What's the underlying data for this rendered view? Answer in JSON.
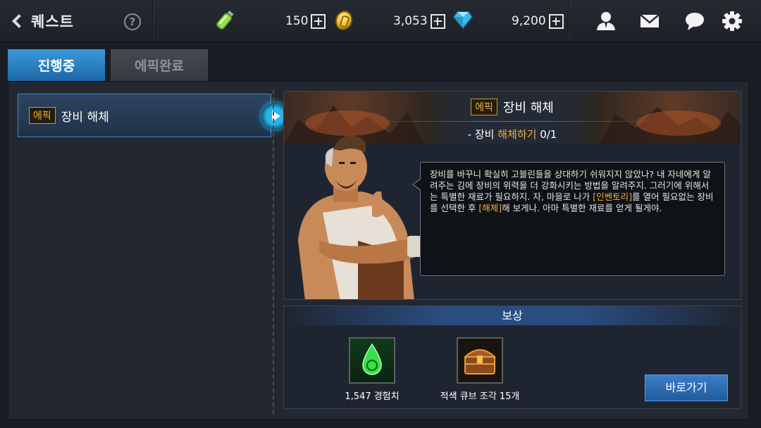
{
  "header": {
    "title": "퀘스트",
    "help_glyph": "?",
    "stamina": "150",
    "gold": "3,053",
    "gems": "9,200",
    "icons": [
      "back-chevron-icon",
      "help-icon",
      "stamina-potion-icon",
      "gold-coin-icon",
      "gem-icon",
      "friend-icon",
      "mail-icon",
      "chat-icon",
      "settings-icon"
    ]
  },
  "tabs": [
    {
      "label": "진행중",
      "active": true
    },
    {
      "label": "에픽완료",
      "active": false
    }
  ],
  "quest_list": [
    {
      "badge": "에픽",
      "name": "장비 해체",
      "selected": true
    }
  ],
  "detail": {
    "badge": "에픽",
    "title": "장비 해체",
    "objective_prefix": "- 장비 ",
    "objective_action": "해체하기",
    "objective_progress": " 0/1",
    "dialog": {
      "p1": "장비를 바꾸니 확실히 고블린들을 상대하기 쉬워지지 않았나?  내 자네에게 알려주는 김에 장비의 위력을 더 강화시키는 방법을 알려주지. 그러기에 위해서는 특별한 재료가 필요하지.  자, 마을로 나가 ",
      "hl1": "[인벤토리]",
      "p2": "를 열어 필요없는 장비를 선택한 후 ",
      "hl2": "[해체]",
      "p3": "해 보게나. 아마 특별한 재료를 얻게 될게야."
    }
  },
  "reward": {
    "header": "보상",
    "items": [
      {
        "label": "1,547 경험치",
        "icon": "exp-drop-icon"
      },
      {
        "label": "적색 큐브 조각 15개",
        "icon": "treasure-chest-icon"
      }
    ],
    "goto_label": "바로가기"
  },
  "colors": {
    "accent_blue": "#1b67a8",
    "highlight_orange": "#f1b13b",
    "panel_bg": "#232830"
  }
}
